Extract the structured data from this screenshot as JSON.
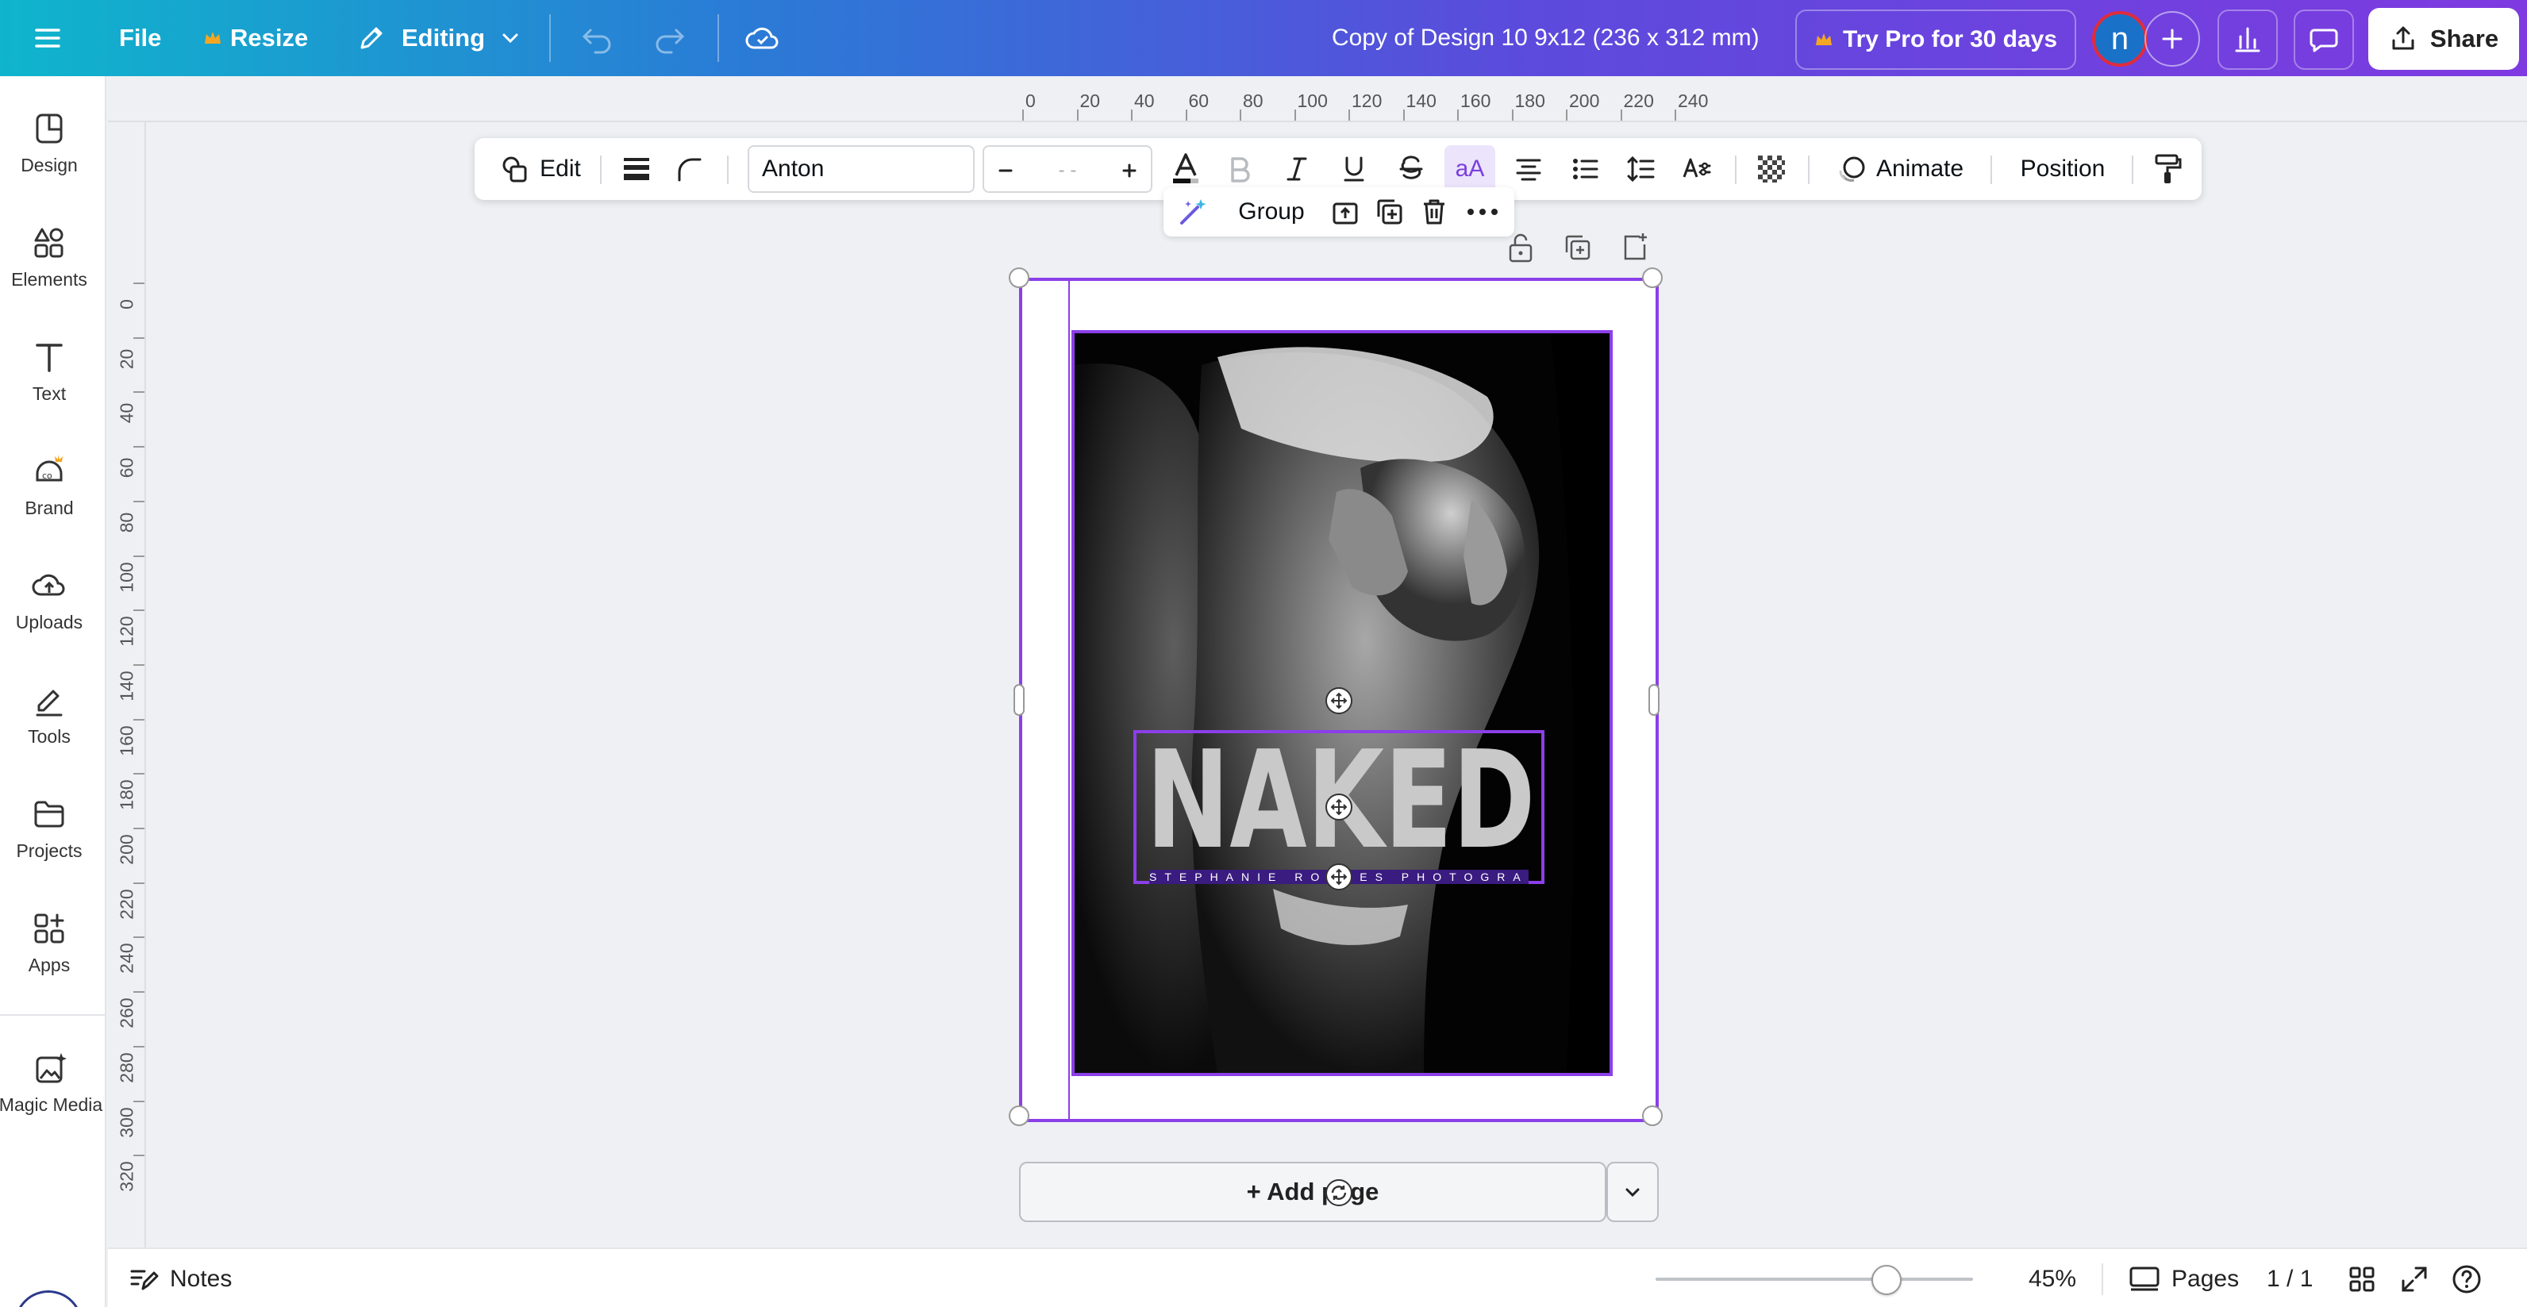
{
  "topbar": {
    "file_label": "File",
    "resize_label": "Resize",
    "editing_label": "Editing",
    "doc_title": "Copy of  Design 10 9x12 (236 x 312 mm)",
    "try_pro_label": "Try Pro for 30 days",
    "avatar_initial": "n",
    "share_label": "Share"
  },
  "sidebar": {
    "items": [
      {
        "label": "Design",
        "icon": "design-icon"
      },
      {
        "label": "Elements",
        "icon": "elements-icon"
      },
      {
        "label": "Text",
        "icon": "text-icon"
      },
      {
        "label": "Brand",
        "icon": "brand-icon"
      },
      {
        "label": "Uploads",
        "icon": "uploads-icon"
      },
      {
        "label": "Tools",
        "icon": "tools-icon"
      },
      {
        "label": "Projects",
        "icon": "projects-icon"
      },
      {
        "label": "Apps",
        "icon": "apps-icon"
      },
      {
        "label": "Magic Media",
        "icon": "magic-media-icon"
      }
    ]
  },
  "ruler": {
    "top": [
      "0",
      "20",
      "40",
      "60",
      "80",
      "100",
      "120",
      "140",
      "160",
      "180",
      "200",
      "220",
      "240"
    ],
    "left": [
      "0",
      "20",
      "40",
      "60",
      "80",
      "100",
      "120",
      "140",
      "160",
      "180",
      "200",
      "220",
      "240",
      "260",
      "280",
      "300",
      "320"
    ]
  },
  "format_toolbar": {
    "edit_label": "Edit",
    "font_name": "Anton",
    "font_size": "- -",
    "case_label": "aA",
    "animate_label": "Animate",
    "position_label": "Position"
  },
  "group_toolbar": {
    "group_label": "Group"
  },
  "canvas": {
    "title_text": "NAKED",
    "title_letters": [
      "N",
      "A",
      "K",
      "E",
      "D"
    ],
    "subtitle_text": "STEPHANIE ROWLES PHOTOGRAPHY"
  },
  "add_page_label": "+ Add page",
  "bottombar": {
    "notes_label": "Notes",
    "zoom_value": "45%",
    "zoom_level": 0.45,
    "pages_label": "Pages",
    "page_count": "1 / 1"
  },
  "colors": {
    "selection": "#8b3fe8",
    "brand_gradient_start": "#0fb5cc",
    "brand_gradient_end": "#7e3ae0",
    "pro_crown": "#f5a623"
  }
}
